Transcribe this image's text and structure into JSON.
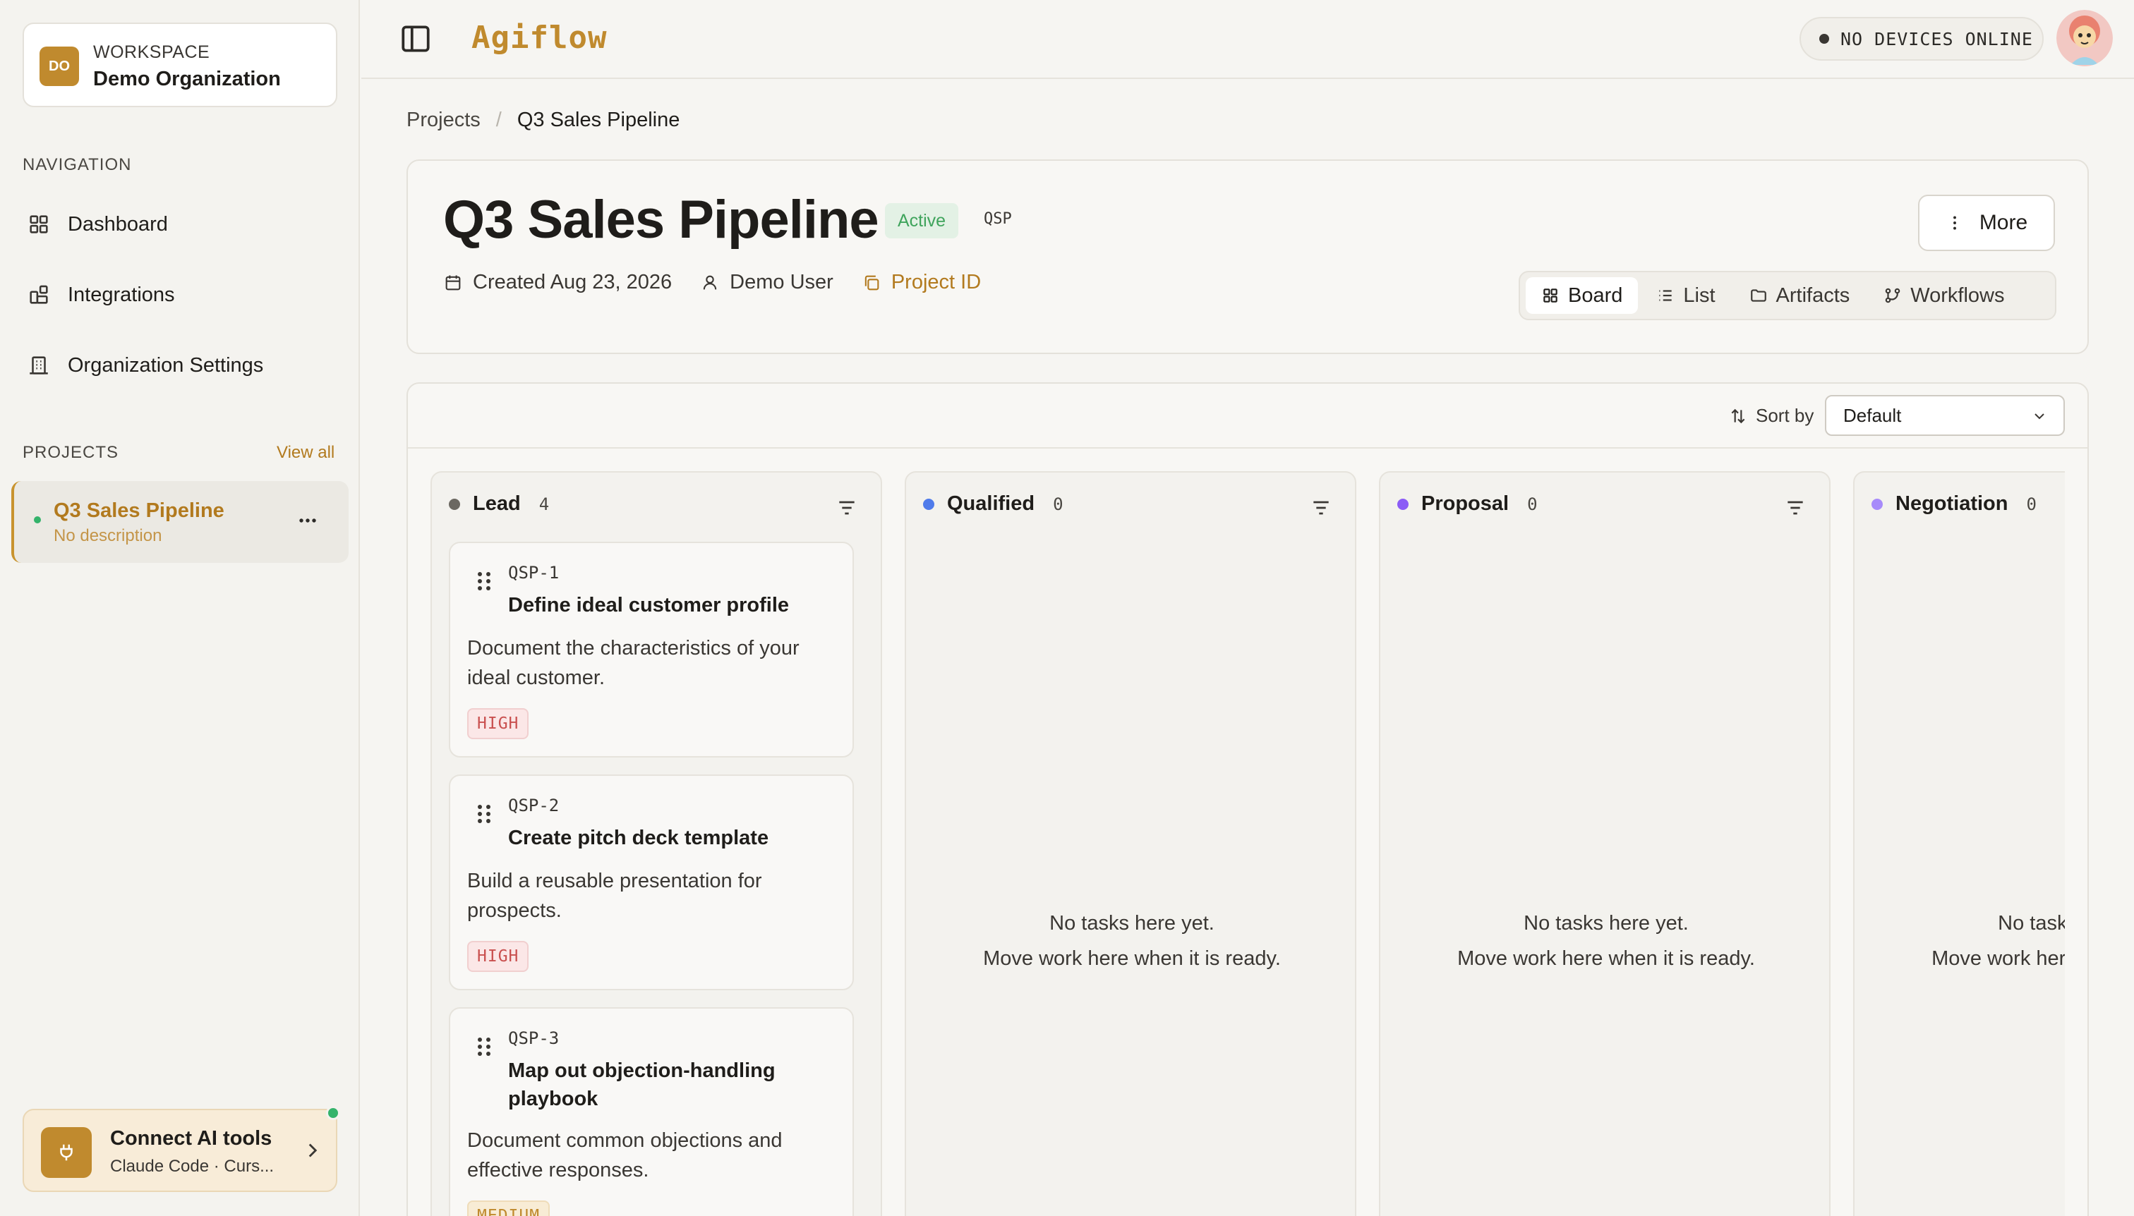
{
  "sidebar": {
    "workspace": {
      "initials": "DO",
      "eyebrow": "WORKSPACE",
      "name": "Demo Organization"
    },
    "navigation_label": "NAVIGATION",
    "nav_items": [
      {
        "label": "Dashboard",
        "icon": "grid-icon"
      },
      {
        "label": "Integrations",
        "icon": "integrations-icon"
      },
      {
        "label": "Organization Settings",
        "icon": "building-icon"
      }
    ],
    "projects_label": "PROJECTS",
    "view_all": "View all",
    "projects": [
      {
        "name": "Q3 Sales Pipeline",
        "description": "No description"
      }
    ],
    "connect": {
      "title": "Connect AI tools",
      "subtitle": "Claude Code · Curs...",
      "icon": "plug-icon"
    }
  },
  "topbar": {
    "brand": "Agiflow",
    "devices_status": "NO DEVICES ONLINE"
  },
  "breadcrumb": {
    "parent": "Projects",
    "separator": "/",
    "current": "Q3 Sales Pipeline"
  },
  "project": {
    "title": "Q3 Sales Pipeline",
    "status": "Active",
    "key": "QSP",
    "created": "Created Aug 23, 2026",
    "owner": "Demo User",
    "id_link": "Project ID",
    "more_label": "More"
  },
  "view_tabs": [
    {
      "label": "Board",
      "icon": "board-icon",
      "active": true
    },
    {
      "label": "List",
      "icon": "list-icon",
      "active": false
    },
    {
      "label": "Artifacts",
      "icon": "folder-icon",
      "active": false
    },
    {
      "label": "Workflows",
      "icon": "workflow-icon",
      "active": false
    }
  ],
  "board": {
    "sort_label": "Sort by",
    "sort_value": "Default",
    "columns": [
      {
        "name": "Lead",
        "count": "4",
        "color": "#6b6861",
        "cards": [
          {
            "key": "QSP-1",
            "title": "Define ideal customer profile",
            "description": "Document the characteristics of your ideal customer.",
            "priority": "HIGH"
          },
          {
            "key": "QSP-2",
            "title": "Create pitch deck template",
            "description": "Build a reusable presentation for prospects.",
            "priority": "HIGH"
          },
          {
            "key": "QSP-3",
            "title": "Map out objection-handling playbook",
            "description": "Document common objections and effective responses.",
            "priority": "MEDIUM"
          }
        ]
      },
      {
        "name": "Qualified",
        "count": "0",
        "color": "#4f7bea",
        "empty_line1": "No tasks here yet.",
        "empty_line2": "Move work here when it is ready."
      },
      {
        "name": "Proposal",
        "count": "0",
        "color": "#8b5cf6",
        "empty_line1": "No tasks here yet.",
        "empty_line2": "Move work here when it is ready."
      },
      {
        "name": "Negotiation",
        "count": "0",
        "color": "#a78bfa",
        "empty_line1": "No tasks here yet.",
        "empty_line2": "Move work here when it is ready."
      }
    ]
  }
}
